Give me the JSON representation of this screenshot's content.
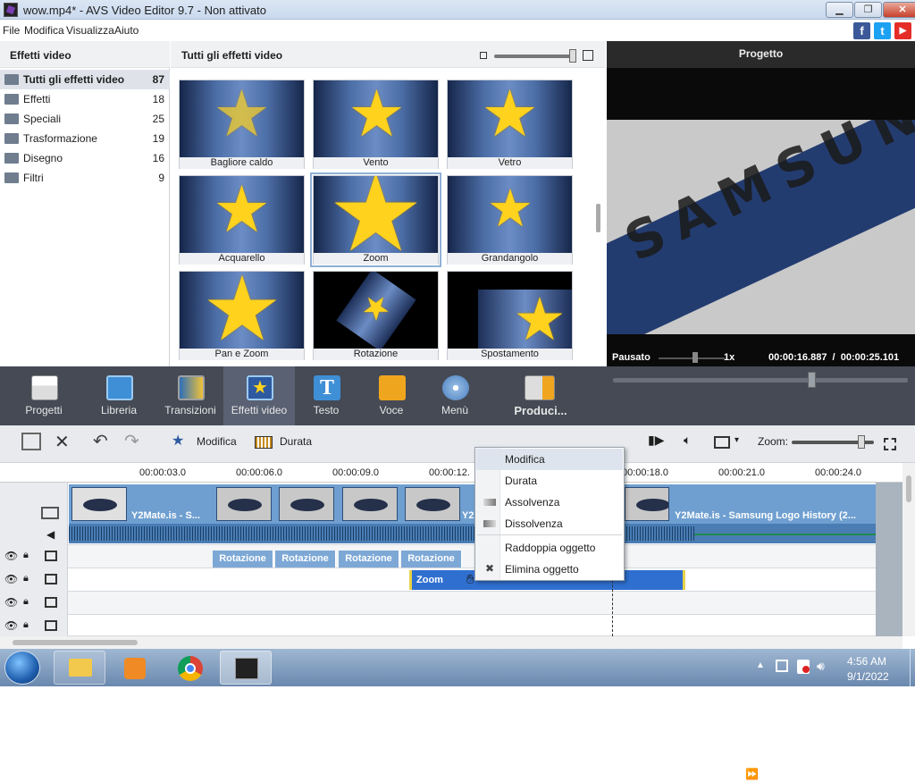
{
  "window": {
    "title": "wow.mp4* - AVS Video Editor 9.7 - Non attivato",
    "minimize": "▁",
    "restore": "❐",
    "close": "✕"
  },
  "menu": {
    "items": [
      "File",
      "Modifica",
      "Visualizza",
      "Aiuto"
    ]
  },
  "social": {
    "facebook": "f",
    "twitter": "t",
    "youtube": "▶"
  },
  "left_panel": {
    "title": "Effetti video",
    "categories": [
      {
        "label": "Tutti gli effetti video",
        "count": "87"
      },
      {
        "label": "Effetti",
        "count": "18"
      },
      {
        "label": "Speciali",
        "count": "25"
      },
      {
        "label": "Trasformazione",
        "count": "19"
      },
      {
        "label": "Disegno",
        "count": "16"
      },
      {
        "label": "Filtri",
        "count": "9"
      }
    ]
  },
  "effects": {
    "title": "Tutti gli effetti video",
    "tiles": [
      "Bagliore caldo",
      "Vento",
      "Vetro",
      "Acquarello",
      "Zoom",
      "Grandangolo",
      "Pan e Zoom",
      "Rotazione",
      "Spostamento"
    ],
    "selected": "Zoom"
  },
  "preview": {
    "title": "Progetto",
    "logo_text": "SAMSUN",
    "status": "Pausato",
    "speed": "1x",
    "time": "00:00:16.887  /  00:00:25.101"
  },
  "toolbar": {
    "buttons": [
      "Progetti",
      "Libreria",
      "Transizioni",
      "Effetti video",
      "Testo",
      "Voce",
      "Menù",
      "Produci..."
    ],
    "selected": "Effetti video",
    "controls": {
      "play": "▶",
      "stop": "■",
      "prev": "⏮",
      "next": "⏭",
      "frame": "⏩"
    }
  },
  "timeline_toolbar": {
    "edit": "Modifica",
    "duration": "Durata",
    "zoom_label": "Zoom:",
    "zoom_level": 0.85
  },
  "ruler": {
    "ticks": [
      "00:00:03.0",
      "00:00:06.0",
      "00:00:09.0",
      "00:00:12.",
      "00:00:18.0",
      "00:00:21.0",
      "00:00:24.0"
    ]
  },
  "timeline": {
    "video_clip_1": "Y2Mate.is - S...",
    "video_clip_2": "Y2Mate.is - Samsung Logo History (2...",
    "video_marker": "Y2",
    "fx_clips": [
      "Rotazione",
      "Rotazione",
      "Rotazione",
      "Rotazione"
    ],
    "zoom_clip": "Zoom"
  },
  "context_menu": {
    "items": [
      "Modifica",
      "Durata",
      "Assolvenza",
      "Dissolvenza",
      "Raddoppia oggetto",
      "Elimina oggetto"
    ],
    "highlighted": "Modifica"
  },
  "taskbar": {
    "time": "4:56 AM",
    "date": "9/1/2022"
  },
  "colors": {
    "toolbar": "#454a55",
    "selected_tool": "#5a6172",
    "track_blue": "#6f9fd0",
    "zoom_clip": "#2f6fd0",
    "star": "#ffd21e"
  }
}
